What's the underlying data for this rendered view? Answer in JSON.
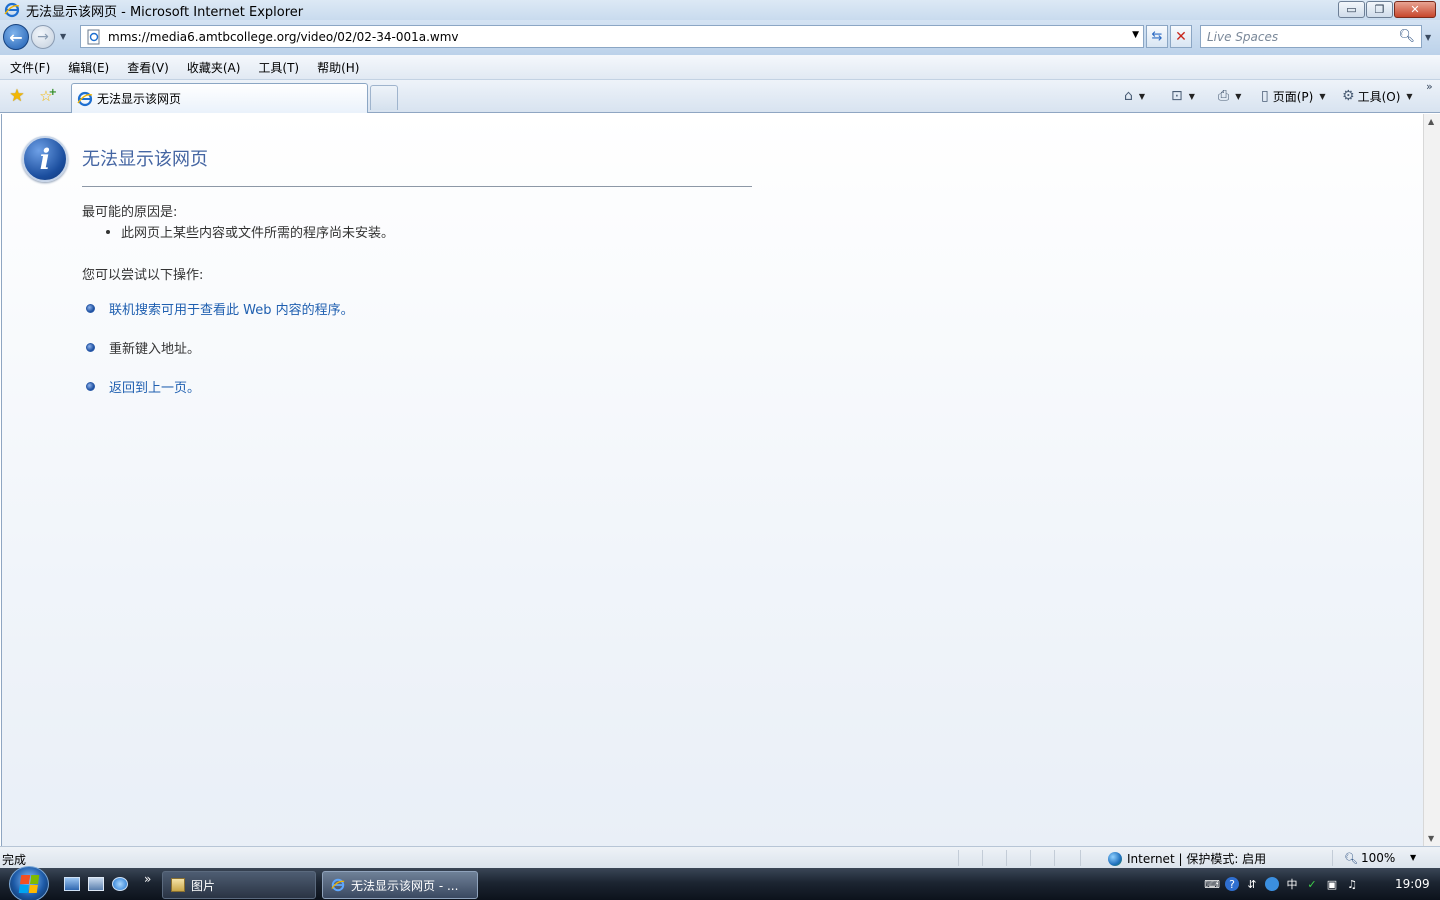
{
  "window": {
    "title": "无法显示该网页 - Microsoft Internet Explorer",
    "controls": {
      "minimize": "▭",
      "maximize": "❐",
      "close": "✕"
    }
  },
  "address_bar": {
    "url": "mms://media6.amtbcollege.org/video/02/02-34-001a.wmv"
  },
  "search": {
    "placeholder": "Live Spaces"
  },
  "menu": [
    "文件(F)",
    "编辑(E)",
    "查看(V)",
    "收藏夹(A)",
    "工具(T)",
    "帮助(H)"
  ],
  "tabs": {
    "active_label": "无法显示该网页"
  },
  "command_bar": {
    "page_label": "页面(P)",
    "tools_label": "工具(O)"
  },
  "page": {
    "title": "无法显示该网页",
    "reason_heading": "最可能的原因是:",
    "reasons": [
      "此网页上某些内容或文件所需的程序尚未安装。"
    ],
    "try_heading": "您可以尝试以下操作:",
    "actions": [
      {
        "text": "联机搜索可用于查看此 Web 内容的程序。",
        "link": true
      },
      {
        "text": "重新键入地址。",
        "link": false
      },
      {
        "text": "返回到上一页。",
        "link": true
      }
    ]
  },
  "status_bar": {
    "status": "完成",
    "zone": "Internet | 保护模式: 启用",
    "zoom": "100%"
  },
  "taskbar": {
    "buttons": [
      {
        "label": "图片",
        "active": false
      },
      {
        "label": "无法显示该网页 - ...",
        "active": true
      }
    ],
    "clock": "19:09"
  },
  "colors": {
    "link": "#1f5fb0",
    "title": "#4465a2",
    "taskbar": "#1c2532"
  }
}
